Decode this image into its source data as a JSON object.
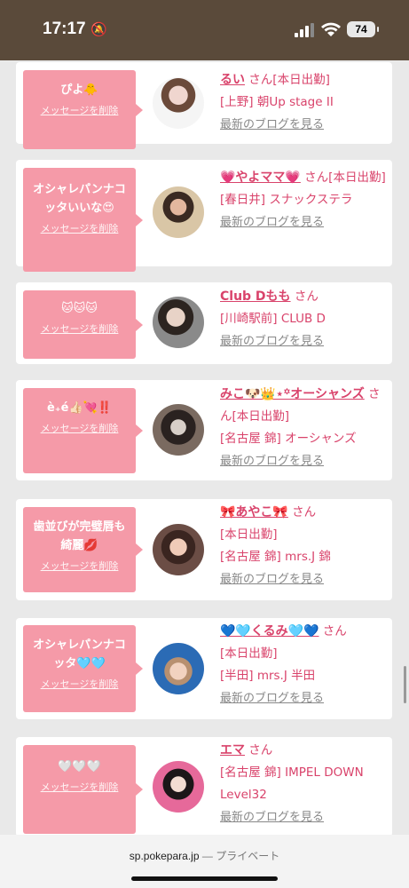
{
  "status": {
    "time": "17:17",
    "battery": "74"
  },
  "colors": {
    "bubble": "#f59aa8",
    "link": "#d9436b",
    "muted": "#888888"
  },
  "messages": [
    {
      "msg": "ぴよ🐥",
      "del": "メッセージを削除",
      "name": "るい",
      "san": "さん",
      "line1": "[本日出勤]",
      "line2": "[上野] 朝Up stage II",
      "blog": "最新のブログを見る"
    },
    {
      "msg": "オシャレパンナコッタいいな😍",
      "del": "メッセージを削除",
      "name": "💗やよママ💗",
      "san": "さん",
      "line1": "[本日出勤]",
      "line2": "[春日井] スナックステラ",
      "blog": "最新のブログを見る"
    },
    {
      "msg": "🐱🐱🐱",
      "del": "メッセージを削除",
      "name": "Club Dもも",
      "san": "さん",
      "line1": "",
      "line2": "[川崎駅前] CLUB D",
      "blog": "最新のブログを見る"
    },
    {
      "msg": "è₊é👍🏻💘‼️",
      "del": "メッセージを削除",
      "name": "みこ🐶👑⋆꙳オーシャンズ",
      "san": "さん",
      "line1": "[本日出勤]",
      "line2": "[名古屋 錦] オーシャンズ",
      "blog": "最新のブログを見る"
    },
    {
      "msg": "歯並びが完璧唇も綺麗💋",
      "del": "メッセージを削除",
      "name": "🎀あやこ🎀",
      "san": "さん",
      "line1": "[本日出勤]",
      "line2": "[名古屋 錦] mrs.J 錦",
      "blog": "最新のブログを見る"
    },
    {
      "msg": "オシャレパンナコッタ🩵🩵",
      "del": "メッセージを削除",
      "name": "💙🩵くるみ🩵💙",
      "san": "さん",
      "line1": "[本日出勤]",
      "line2": "[半田] mrs.J 半田",
      "blog": "最新のブログを見る"
    },
    {
      "msg": "🤍🤍🤍",
      "del": "メッセージを削除",
      "name": "エマ",
      "san": "さん",
      "line1": "",
      "line2": "[名古屋 錦] IMPEL DOWN Level32",
      "blog": "最新のブログを見る"
    }
  ],
  "browser": {
    "domain": "sp.pokepara.jp",
    "mode": "— プライベート"
  }
}
